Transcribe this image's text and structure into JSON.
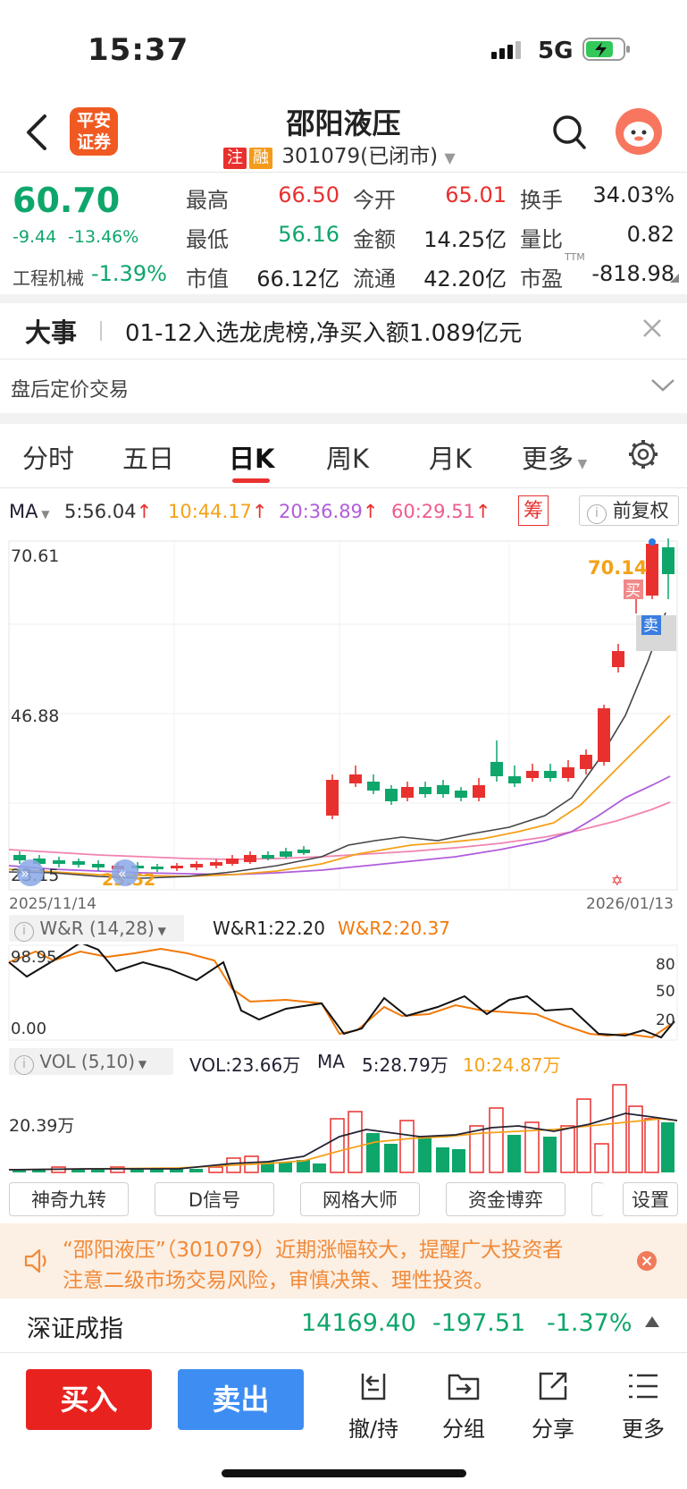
{
  "status_bar": {
    "time": "15:37",
    "network": "5G"
  },
  "header": {
    "logo_line1": "平安",
    "logo_line2": "证券",
    "stock_name": "邵阳液压",
    "tag_zhu": "注",
    "tag_rong": "融",
    "code_status": "301079(已闭市)",
    "colors": {
      "logo": "#f05a22",
      "up": "#e8312f",
      "down": "#0ea66b"
    }
  },
  "quote": {
    "price": "60.70",
    "change": "-9.44",
    "change_pct": "-13.46%",
    "sector": "工程机械",
    "sector_pct": "-1.39%",
    "high_label": "最高",
    "high": "66.50",
    "open_label": "今开",
    "open": "65.01",
    "turnover_label": "换手",
    "turnover": "34.03%",
    "low_label": "最低",
    "low": "56.16",
    "amount_label": "金额",
    "amount": "14.25亿",
    "vol_ratio_label": "量比",
    "vol_ratio": "0.82",
    "mcap_label": "市值",
    "mcap": "66.12亿",
    "float_label": "流通",
    "float": "42.20亿",
    "pe_label": "市盈",
    "pe_sup": "TTM",
    "pe": "-818.98"
  },
  "news": {
    "label": "大事",
    "text": "01-12入选龙虎榜,净买入额1.089亿元"
  },
  "after_hours": {
    "label": "盘后定价交易"
  },
  "tabs": [
    "分时",
    "五日",
    "日K",
    "周K",
    "月K",
    "更多"
  ],
  "active_tab": "日K",
  "ma_line": {
    "label": "MA",
    "ma5": "5:56.04",
    "ma10": "10:44.17",
    "ma20": "20:36.89",
    "ma60": "60:29.51",
    "chou": "筹",
    "adjust": "前复权"
  },
  "kchart": {
    "y_top": "70.61",
    "y_mid": "46.88",
    "y_low": "23.15",
    "low_marker": "23.52",
    "high_marker": "70.14",
    "buy": "买",
    "sell": "卖",
    "date_start": "2025/11/14",
    "date_end": "2026/01/13"
  },
  "wr": {
    "label": "W&R (14,28)",
    "wr1": "W&R1:22.20",
    "wr2": "W&R2:20.37",
    "y_top": "98.95",
    "y_bottom": "0.00",
    "r80": "80",
    "r50": "50",
    "r20": "20"
  },
  "vol": {
    "label": "VOL (5,10)",
    "vol": "VOL:23.66万",
    "ma_label": "MA",
    "ma5": "5:28.79万",
    "ma10": "10:24.87万",
    "y_label": "20.39万"
  },
  "tools": [
    "神奇九转",
    "D信号",
    "网格大师",
    "资金博弈",
    "设置"
  ],
  "warning": {
    "line1": "“邵阳液压”（301079）近期涨幅较大，提醒广大投资者",
    "line2": "注意二级市场交易风险，审慎决策、理性投资。"
  },
  "index": {
    "name": "深证成指",
    "value": "14169.40",
    "change": "-197.51",
    "pct": "-1.37%"
  },
  "bottom": {
    "buy": "买入",
    "sell": "卖出",
    "cancel": "撤/持",
    "group": "分组",
    "share": "分享",
    "more": "更多"
  }
}
